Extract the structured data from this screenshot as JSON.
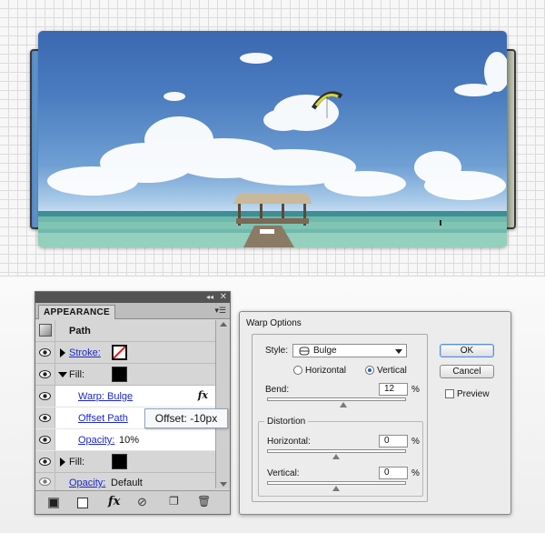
{
  "appearance_panel": {
    "tab_label": "APPEARANCE",
    "header_label": "Path",
    "rows": [
      {
        "label": "Stroke:"
      },
      {
        "label": "Fill:"
      },
      {
        "label": "Warp: Bulge",
        "fx": "fx"
      },
      {
        "label": "Offset Path"
      },
      {
        "label": "Opacity:",
        "value": "10%"
      },
      {
        "label": "Fill:"
      },
      {
        "label": "Opacity:",
        "value": "Default"
      }
    ],
    "footer_fx": "fx"
  },
  "tooltip": {
    "text": "Offset: -10px"
  },
  "warp_dialog": {
    "title": "Warp Options",
    "style_label": "Style:",
    "style_value": "Bulge",
    "orientation_horizontal": "Horizontal",
    "orientation_vertical": "Vertical",
    "orientation_selected": "Vertical",
    "bend_label": "Bend:",
    "bend_value": "12",
    "percent": "%",
    "distortion_label": "Distortion",
    "horizontal_label": "Horizontal:",
    "horizontal_value": "0",
    "vertical_label": "Vertical:",
    "vertical_value": "0",
    "ok_label": "OK",
    "cancel_label": "Cancel",
    "preview_label": "Preview",
    "preview_checked": false
  },
  "colors": {
    "link": "#1d28c8",
    "panel_bg": "#d6d6d6",
    "radio_selected": "#2a5fc7"
  }
}
